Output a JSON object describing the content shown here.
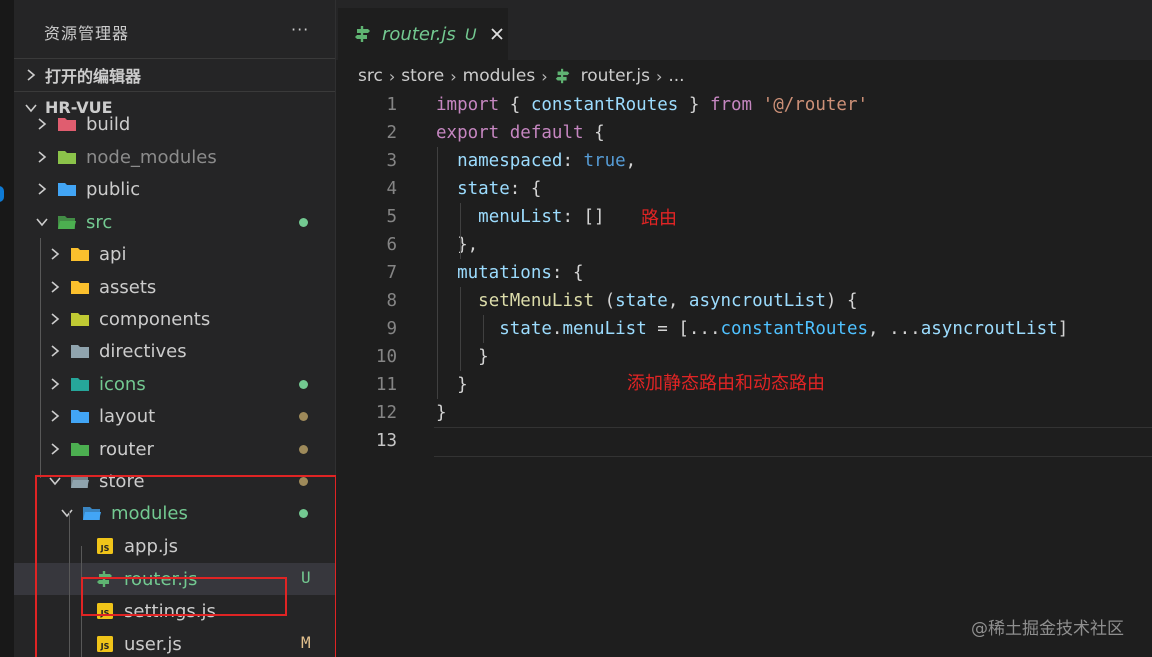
{
  "explorer": {
    "title": "资源管理器",
    "more": "···",
    "open_editors": "打开的编辑器",
    "project": "HR-VUE",
    "tree": [
      {
        "label": "build",
        "color": "#cccccc",
        "icon": "folder-build-icon"
      },
      {
        "label": "node_modules",
        "color": "#8c8c8c",
        "icon": "folder-node-icon"
      },
      {
        "label": "public",
        "color": "#cccccc",
        "icon": "folder-public-icon"
      },
      {
        "label": "src",
        "color": "#73c991",
        "icon": "folder-src-icon",
        "badge_color": "#73c991"
      },
      {
        "label": "api",
        "color": "#cccccc",
        "icon": "folder-api-icon"
      },
      {
        "label": "assets",
        "color": "#cccccc",
        "icon": "folder-assets-icon"
      },
      {
        "label": "components",
        "color": "#cccccc",
        "icon": "folder-components-icon"
      },
      {
        "label": "directives",
        "color": "#cccccc",
        "icon": "folder-directives-icon"
      },
      {
        "label": "icons",
        "color": "#73c991",
        "icon": "folder-icons-icon",
        "badge_color": "#73c991"
      },
      {
        "label": "layout",
        "color": "#cccccc",
        "icon": "folder-layout-icon",
        "badge_color": "#9e8a5a"
      },
      {
        "label": "router",
        "color": "#cccccc",
        "icon": "folder-router-icon",
        "badge_color": "#9e8a5a"
      },
      {
        "label": "store",
        "color": "#cccccc",
        "icon": "folder-store-icon",
        "badge_color": "#9e8a5a"
      },
      {
        "label": "modules",
        "color": "#73c991",
        "icon": "folder-modules-icon",
        "badge_color": "#73c991"
      },
      {
        "label": "app.js",
        "color": "#cccccc",
        "icon": "js-file-icon"
      },
      {
        "label": "router.js",
        "color": "#73c991",
        "icon": "router-file-icon",
        "status": "U",
        "status_color": "#73c991"
      },
      {
        "label": "settings.js",
        "color": "#cccccc",
        "icon": "js-file-icon"
      },
      {
        "label": "user.js",
        "color": "#cccccc",
        "icon": "js-file-icon",
        "status": "M",
        "status_color": "#e2c08d"
      }
    ]
  },
  "tab": {
    "title": "router.js",
    "status": "U"
  },
  "breadcrumb": [
    "src",
    "store",
    "modules",
    "router.js",
    "..."
  ],
  "code": {
    "line_numbers": [
      "1",
      "2",
      "3",
      "4",
      "5",
      "6",
      "7",
      "8",
      "9",
      "10",
      "11",
      "12",
      "13"
    ],
    "lines": [
      [
        [
          "import",
          "kw"
        ],
        [
          " { ",
          "pn"
        ],
        [
          "constantRoutes",
          "var"
        ],
        [
          " } ",
          "pn"
        ],
        [
          "from",
          "kw"
        ],
        [
          " ",
          "pn"
        ],
        [
          "'@/router'",
          "str"
        ]
      ],
      [
        [
          "export",
          "kw"
        ],
        [
          " ",
          "pn"
        ],
        [
          "default",
          "kw"
        ],
        [
          " {",
          "pn"
        ]
      ],
      [
        [
          "  ",
          "pn"
        ],
        [
          "namespaced",
          "var"
        ],
        [
          ": ",
          "pn"
        ],
        [
          "true",
          "kw2"
        ],
        [
          ",",
          "pn"
        ]
      ],
      [
        [
          "  ",
          "pn"
        ],
        [
          "state",
          "var"
        ],
        [
          ": {",
          "pn"
        ]
      ],
      [
        [
          "    ",
          "pn"
        ],
        [
          "menuList",
          "var"
        ],
        [
          ": []",
          "pn"
        ]
      ],
      [
        [
          "  },",
          "pn"
        ]
      ],
      [
        [
          "  ",
          "pn"
        ],
        [
          "mutations",
          "var"
        ],
        [
          ": {",
          "pn"
        ]
      ],
      [
        [
          "    ",
          "pn"
        ],
        [
          "setMenuList",
          "fn"
        ],
        [
          " (",
          "pn"
        ],
        [
          "state",
          "var"
        ],
        [
          ", ",
          "pn"
        ],
        [
          "asyncroutList",
          "var"
        ],
        [
          ") {",
          "pn"
        ]
      ],
      [
        [
          "      ",
          "pn"
        ],
        [
          "state",
          "var"
        ],
        [
          ".",
          "pn"
        ],
        [
          "menuList",
          "var"
        ],
        [
          " = [...",
          "pn"
        ],
        [
          "constantRoutes",
          "cst"
        ],
        [
          ", ...",
          "pn"
        ],
        [
          "asyncroutList",
          "var"
        ],
        [
          "]",
          "pn"
        ]
      ],
      [
        [
          "    }",
          "pn"
        ]
      ],
      [
        [
          "  }",
          "pn"
        ]
      ],
      [
        [
          "}",
          "pn"
        ]
      ],
      [
        [
          "",
          "pn"
        ]
      ]
    ]
  },
  "annotations": {
    "route": "路由",
    "add_routes": "添加静态路由和动态路由"
  },
  "watermark": "@稀土掘金技术社区"
}
